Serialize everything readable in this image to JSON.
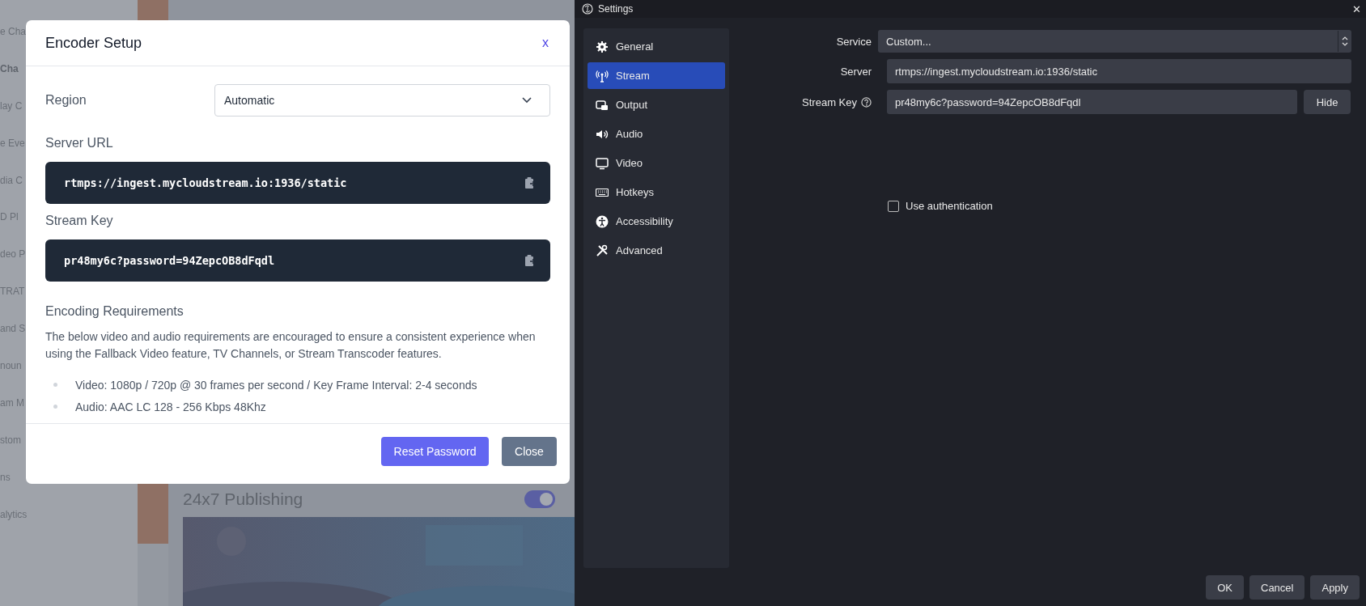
{
  "background_page": {
    "sidebar_items": [
      {
        "label": "e Cha",
        "selected": false
      },
      {
        "label": "Cha",
        "selected": true
      },
      {
        "label": "lay C",
        "selected": false
      },
      {
        "label": "e Eve",
        "selected": false
      },
      {
        "label": "dia C",
        "selected": false
      },
      {
        "label": "D Pl",
        "selected": false
      },
      {
        "label": "deo P",
        "selected": false
      },
      {
        "label": "TRAT",
        "selected": false
      },
      {
        "label": "and S",
        "selected": false
      },
      {
        "label": "noun",
        "selected": false
      },
      {
        "label": "am M",
        "selected": false
      },
      {
        "label": "stom",
        "selected": false
      },
      {
        "label": "ns",
        "selected": false
      },
      {
        "label": "alytics",
        "selected": false
      }
    ],
    "publishing": {
      "title": "24x7 Publishing",
      "on": true
    }
  },
  "modal": {
    "title": "Encoder Setup",
    "close": "x",
    "region": {
      "label": "Region",
      "value": "Automatic"
    },
    "server_url": {
      "label": "Server URL",
      "value": "rtmps://ingest.mycloudstream.io:1936/static"
    },
    "stream_key": {
      "label": "Stream Key",
      "value": "pr48my6c?password=94ZepcOB8dFqdl"
    },
    "requirements": {
      "title": "Encoding Requirements",
      "text": "The below video and audio requirements are encouraged to ensure a consistent experience when using the Fallback Video feature, TV Channels, or Stream Transcoder features.",
      "items": [
        "Video: 1080p / 720p @ 30 frames per second / Key Frame Interval: 2-4 seconds",
        "Audio: AAC LC 128 - 256 Kbps 48Khz"
      ]
    },
    "buttons": [
      {
        "label": "Reset Password",
        "kind": "primary"
      },
      {
        "label": "Close",
        "kind": "secondary"
      }
    ]
  },
  "settings": {
    "title": "Settings",
    "close": "✕",
    "nav": [
      {
        "label": "General",
        "selected": false
      },
      {
        "label": "Stream",
        "selected": true
      },
      {
        "label": "Output",
        "selected": false
      },
      {
        "label": "Audio",
        "selected": false
      },
      {
        "label": "Video",
        "selected": false
      },
      {
        "label": "Hotkeys",
        "selected": false
      },
      {
        "label": "Accessibility",
        "selected": false
      },
      {
        "label": "Advanced",
        "selected": false
      }
    ],
    "service": {
      "label": "Service",
      "value": "Custom..."
    },
    "server": {
      "label": "Server",
      "value": "rtmps://ingest.mycloudstream.io:1936/static"
    },
    "stream_key": {
      "label": "Stream Key",
      "value": "pr48my6c?password=94ZepcOB8dFqdl",
      "button": "Hide"
    },
    "use_authentication": {
      "label": "Use authentication",
      "checked": false
    },
    "buttons": [
      "OK",
      "Cancel",
      "Apply"
    ]
  }
}
